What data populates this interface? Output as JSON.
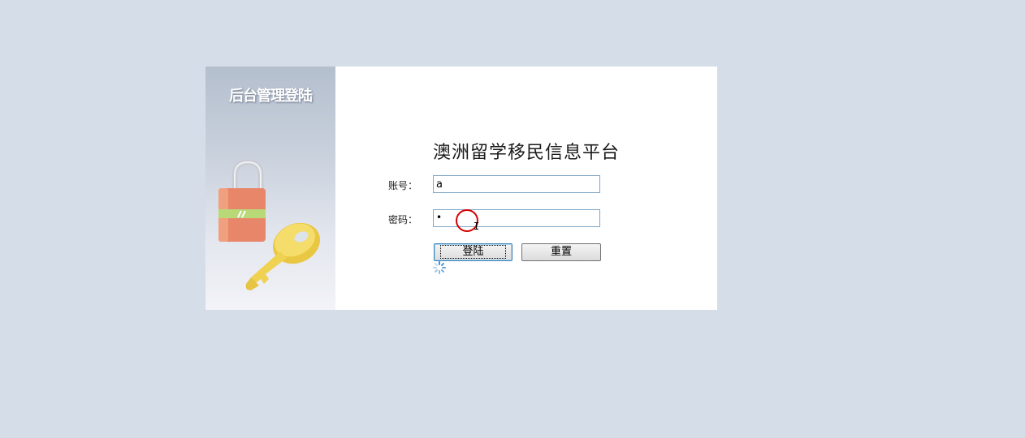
{
  "side": {
    "title": "后台管理登陆",
    "lock_colors": {
      "body": "#e8866a",
      "stripe": "#b9d978",
      "shackle": "#c9ccd3"
    },
    "key_color": "#f2d85a"
  },
  "main": {
    "title": "澳洲留学移民信息平台"
  },
  "form": {
    "account_label": "账号：",
    "account_value": "a",
    "password_label": "密码：",
    "password_value": "•",
    "login_label": "登陆",
    "reset_label": "重置"
  },
  "icons": {
    "spinner": "loading-spinner-icon",
    "cursor": "text-cursor-icon"
  },
  "colors": {
    "background": "#d5dee8",
    "input_border": "#7fa6c6",
    "spinner": "#3d8ed8",
    "click_marker": "#d40000"
  }
}
